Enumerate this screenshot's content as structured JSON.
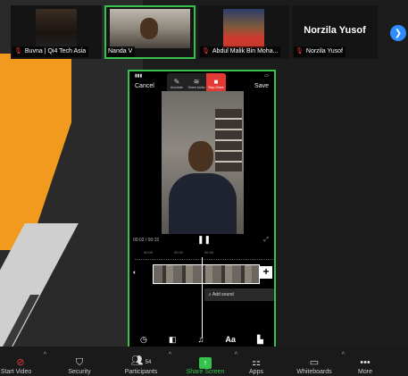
{
  "participants": [
    {
      "name": "Buvna | Qi4 Tech Asia",
      "muted": true,
      "active": false
    },
    {
      "name": "Nanda V",
      "muted": false,
      "active": true
    },
    {
      "name": "Abdul Malik Bin Moha...",
      "muted": true,
      "active": false
    },
    {
      "name": "Norzila Yusof",
      "muted": true,
      "active": false,
      "display_name": "Norzila Yusof"
    }
  ],
  "phone": {
    "cancel": "Cancel",
    "save": "Save",
    "tools": [
      {
        "icon": "pen-icon",
        "label": "Annotate"
      },
      {
        "icon": "wifi-icon",
        "label": "Share Audio"
      },
      {
        "icon": "stop-icon",
        "label": "Stop Share"
      }
    ],
    "time": "00:02 / 00:15",
    "ticks": [
      "00:00",
      "00:02",
      "00:04"
    ],
    "add_sound": "Add sound",
    "bottom_tools": [
      "clock-icon",
      "split-icon",
      "music-icon",
      "Aa",
      "sticker-icon"
    ]
  },
  "toolbar": {
    "start_video": "Start Video",
    "security": "Security",
    "participants": "Participants",
    "participants_count": "54",
    "share_screen": "Share Screen",
    "apps": "Apps",
    "whiteboards": "Whiteboards",
    "more": "More"
  },
  "colors": {
    "accent_green": "#35c24a",
    "muted_red": "#e53935",
    "blue": "#2d8cff",
    "orange": "#f29a1e"
  }
}
